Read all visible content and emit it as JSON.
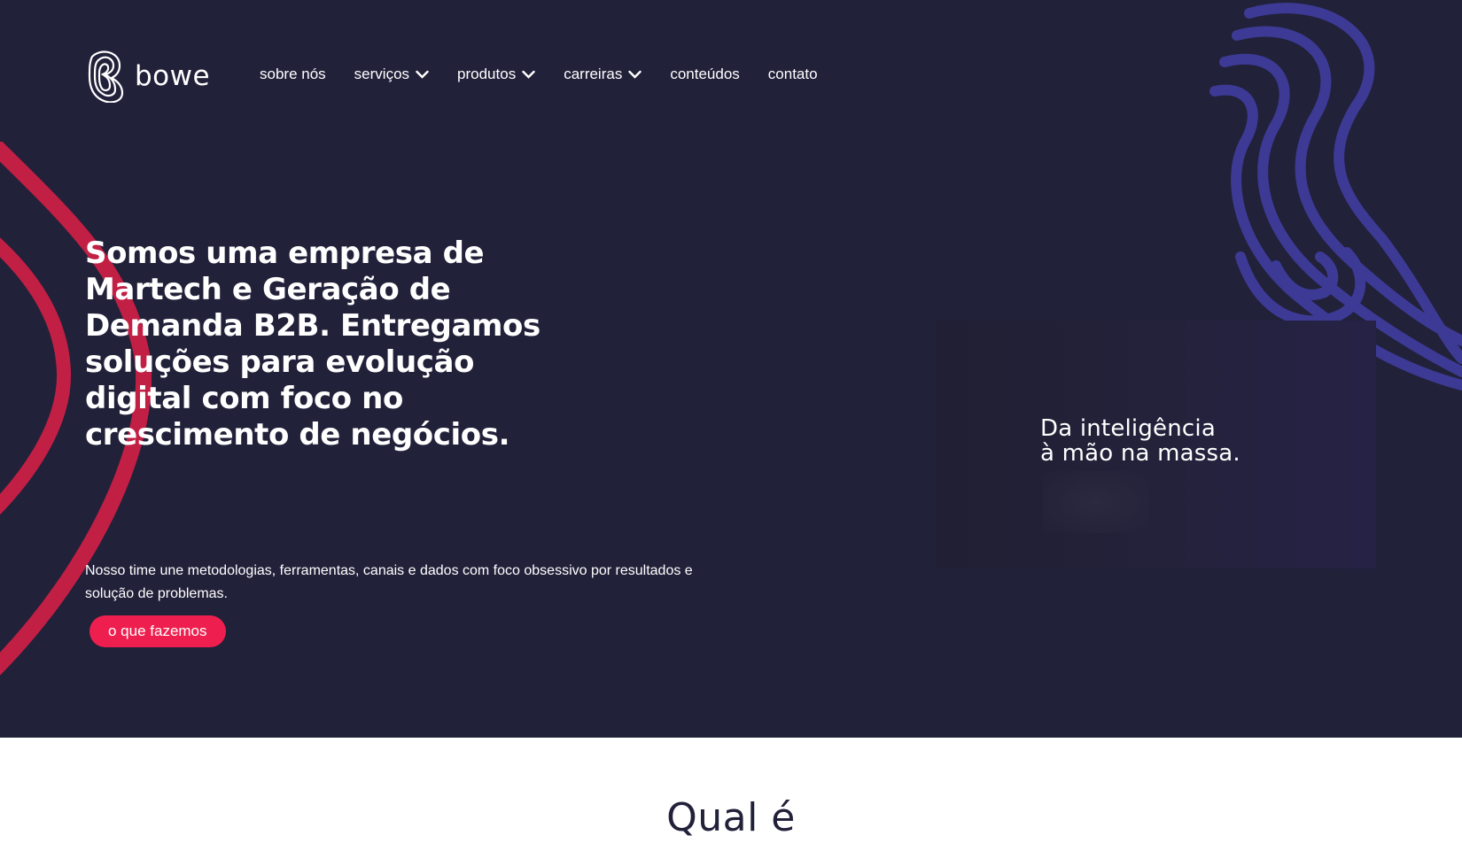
{
  "brand": {
    "name": "bowe",
    "logo_icon": "bowe-b-logo-icon"
  },
  "nav": {
    "items": [
      {
        "label": "sobre nós",
        "has_dropdown": false
      },
      {
        "label": "serviços",
        "has_dropdown": true
      },
      {
        "label": "produtos",
        "has_dropdown": true
      },
      {
        "label": "carreiras",
        "has_dropdown": true
      },
      {
        "label": "conteúdos",
        "has_dropdown": false
      },
      {
        "label": "contato",
        "has_dropdown": false
      }
    ],
    "dropdown_icon": "chevron-down-icon"
  },
  "hero": {
    "title": "Somos uma empresa de Martech e Geração de Demanda B2B. Entregamos soluções para evolução digital com foco no crescimento de negócios.",
    "subtitle": "Nosso time une metodologias, ferramentas, canais e dados com foco obsessivo por resultados e solução de problemas.",
    "cta_label": "o que fazemos"
  },
  "video": {
    "line_1": "Da inteligência",
    "line_2": "à mão na massa."
  },
  "next_section": {
    "heading_partial": "Qual é"
  },
  "colors": {
    "hero_background": "#22213a",
    "accent_red": "#ee1f4f",
    "deco_red": "#c21f45",
    "deco_blue": "#3d3a96",
    "page_background": "#ffffff"
  }
}
